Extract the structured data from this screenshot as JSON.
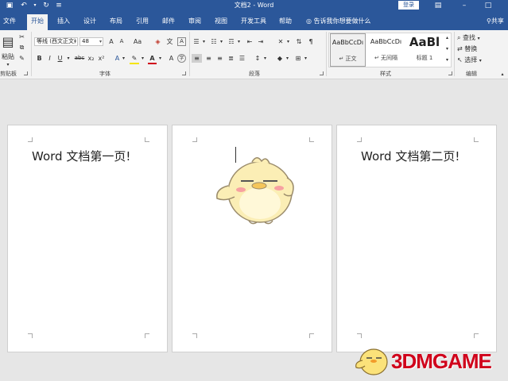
{
  "titlebar": {
    "title": "文档2 - Word",
    "login_label": "登录"
  },
  "tabs": [
    {
      "label": "文件"
    },
    {
      "label": "开始"
    },
    {
      "label": "插入"
    },
    {
      "label": "设计"
    },
    {
      "label": "布局"
    },
    {
      "label": "引用"
    },
    {
      "label": "邮件"
    },
    {
      "label": "审阅"
    },
    {
      "label": "视图"
    },
    {
      "label": "开发工具"
    },
    {
      "label": "帮助"
    }
  ],
  "tell_me": "告诉我你想要做什么",
  "share_label": "共享",
  "ribbon": {
    "clipboard": {
      "label": "剪贴板",
      "paste_label": "粘贴"
    },
    "font": {
      "label": "字体",
      "font_name": "等线 (西文正文)",
      "font_size": "48",
      "grow_label": "A",
      "shrink_label": "A",
      "case_label": "Aa",
      "bold": "B",
      "italic": "I",
      "underline": "U",
      "strike": "abc",
      "sub": "x₂",
      "sup": "x²"
    },
    "paragraph": {
      "label": "段落"
    },
    "styles": {
      "label": "样式",
      "items": [
        {
          "preview": "AaBbCcDı",
          "name": "↵ 正文"
        },
        {
          "preview": "AaBbCcDı",
          "name": "↵ 无间隔"
        },
        {
          "preview": "AaBl",
          "name": "标题 1"
        }
      ]
    },
    "editing": {
      "label": "编辑",
      "find_label": "查找",
      "replace_label": "替换",
      "select_label": "选择"
    }
  },
  "pages": [
    {
      "text": "Word 文档第一页!"
    },
    {
      "text": ""
    },
    {
      "text": "Word 文档第二页!"
    }
  ],
  "watermark": {
    "text": "3DMGAME"
  },
  "colors": {
    "accent": "#2b579a",
    "highlight": "#f5e400",
    "font_color": "#d0021b",
    "watermark": "#d0021b"
  }
}
